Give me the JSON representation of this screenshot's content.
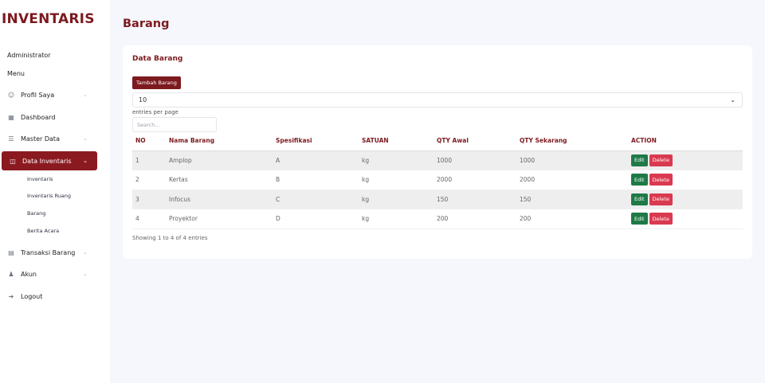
{
  "brand": "INVENTARIS",
  "sidebar": {
    "user_label": "Administrator",
    "menu_label": "Menu",
    "items": [
      {
        "label": "Profil Saya",
        "icon": "user-circle-icon",
        "has_chevron": true
      },
      {
        "label": "Dashboard",
        "icon": "grid-icon",
        "has_chevron": false
      },
      {
        "label": "Master Data",
        "icon": "database-icon",
        "has_chevron": true
      },
      {
        "label": "Data Inventaris",
        "icon": "book-icon",
        "has_chevron": true,
        "active": true
      },
      {
        "label": "Transaksi Barang",
        "icon": "clipboard-icon",
        "has_chevron": true
      },
      {
        "label": "Akun",
        "icon": "person-icon",
        "has_chevron": true
      },
      {
        "label": "Logout",
        "icon": "logout-icon",
        "has_chevron": false
      }
    ],
    "sub_items": [
      "Inventaris",
      "Inventaris Ruang",
      "Barang",
      "Berita Acara"
    ]
  },
  "page_title": "Barang",
  "card": {
    "title": "Data Barang",
    "add_button": "Tambah Barang",
    "entries_value": "10",
    "entries_label": "entries per page",
    "search_placeholder": "Search...",
    "columns": [
      "NO",
      "Nama Barang",
      "Spesifikasi",
      "SATUAN",
      "QTY Awal",
      "QTY Sekarang",
      "ACTION"
    ],
    "rows": [
      {
        "no": "1",
        "nama": "Amplop",
        "spesifikasi": "A",
        "satuan": "kg",
        "qty_awal": "1000",
        "qty_sekarang": "1000"
      },
      {
        "no": "2",
        "nama": "Kertas",
        "spesifikasi": "B",
        "satuan": "kg",
        "qty_awal": "2000",
        "qty_sekarang": "2000"
      },
      {
        "no": "3",
        "nama": "Infocus",
        "spesifikasi": "C",
        "satuan": "kg",
        "qty_awal": "150",
        "qty_sekarang": "150"
      },
      {
        "no": "4",
        "nama": "Proyektor",
        "spesifikasi": "D",
        "satuan": "kg",
        "qty_awal": "200",
        "qty_sekarang": "200"
      }
    ],
    "edit_label": "Edit",
    "delete_label": "Delete",
    "showing": "Showing 1 to 4 of 4 entries"
  },
  "colors": {
    "brand": "#7d1a1f",
    "active_nav": "#8b1a20",
    "edit": "#1f7a47",
    "delete": "#d93a4f",
    "background": "#f5f7fd"
  }
}
